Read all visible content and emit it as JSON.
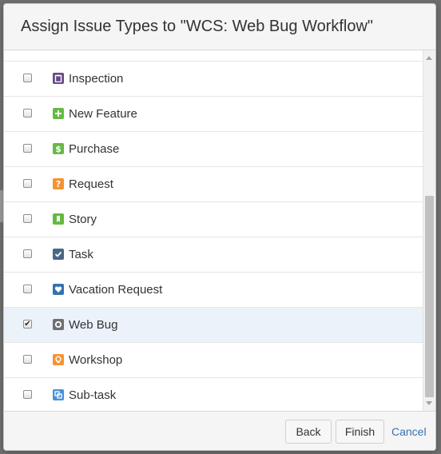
{
  "dialog": {
    "title": "Assign Issue Types to \"WCS: Web Bug Workflow\""
  },
  "issue_types": [
    {
      "label": "Inspection",
      "checked": false,
      "icon": "clipboard-icon",
      "color": "#654982"
    },
    {
      "label": "New Feature",
      "checked": false,
      "icon": "plus-icon",
      "color": "#65ba43"
    },
    {
      "label": "Purchase",
      "checked": false,
      "icon": "dollar-icon",
      "color": "#65ba43"
    },
    {
      "label": "Request",
      "checked": false,
      "icon": "question-icon",
      "color": "#f79232"
    },
    {
      "label": "Story",
      "checked": false,
      "icon": "bookmark-icon",
      "color": "#63ba3c"
    },
    {
      "label": "Task",
      "checked": false,
      "icon": "checkmark-icon",
      "color": "#4a6785"
    },
    {
      "label": "Vacation Request",
      "checked": false,
      "icon": "heart-icon",
      "color": "#3572b0"
    },
    {
      "label": "Web Bug",
      "checked": true,
      "icon": "circle-icon",
      "color": "#707070"
    },
    {
      "label": "Workshop",
      "checked": false,
      "icon": "lightbulb-icon",
      "color": "#f79232"
    },
    {
      "label": "Sub-task",
      "checked": false,
      "icon": "subtask-icon",
      "color": "#4a90d9"
    }
  ],
  "footer": {
    "back_label": "Back",
    "finish_label": "Finish",
    "cancel_label": "Cancel"
  },
  "colors": {
    "link": "#3572b0",
    "selected_row": "#ebf2f9"
  }
}
